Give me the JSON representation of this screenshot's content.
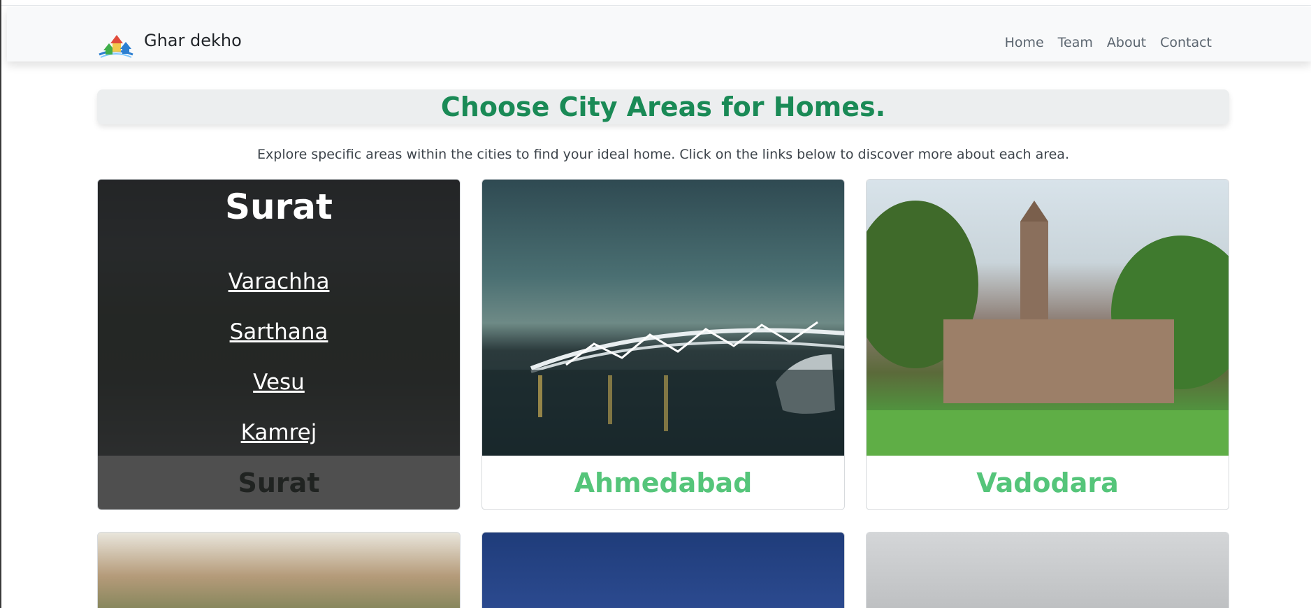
{
  "navbar": {
    "brand": "Ghar dekho",
    "links": [
      "Home",
      "Team",
      "About",
      "Contact"
    ]
  },
  "page": {
    "title": "Choose City Areas for Homes.",
    "subtitle": "Explore specific areas within the cities to find your ideal home. Click on the links below to discover more about each area."
  },
  "cities": [
    {
      "name": "Surat",
      "areas": [
        "Varachha",
        "Sarthana",
        "Vesu",
        "Kamrej"
      ]
    },
    {
      "name": "Ahmedabad"
    },
    {
      "name": "Vadodara"
    }
  ],
  "colors": {
    "accent_green": "#1a8a56",
    "city_name_green": "#55c57a",
    "navbar_bg": "#f8f9fa"
  }
}
